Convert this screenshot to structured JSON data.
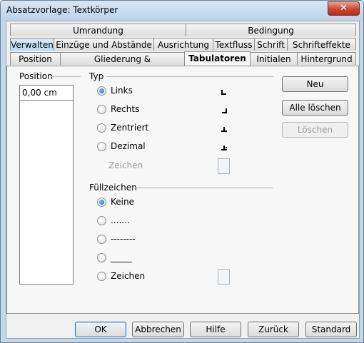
{
  "window": {
    "title": "Absatzvorlage: Textkörper",
    "close_label": "✕"
  },
  "tabs": {
    "row1": [
      "Umrandung",
      "Bedingung"
    ],
    "row2": [
      "Verwalten",
      "Einzüge und Abstände",
      "Ausrichtung",
      "Textfluss",
      "Schrift",
      "Schrifteffekte"
    ],
    "row3": [
      "Position",
      "Gliederung & Nummerierung",
      "Tabulatoren",
      "Initialen",
      "Hintergrund"
    ]
  },
  "position": {
    "label": "Position",
    "value": "0,00 cm"
  },
  "typ": {
    "label": "Typ",
    "options": [
      {
        "label": "Links",
        "checked": true
      },
      {
        "label": "Rechts",
        "checked": false
      },
      {
        "label": "Zentriert",
        "checked": false
      },
      {
        "label": "Dezimal",
        "checked": false
      }
    ],
    "zeichen_label": "Zeichen"
  },
  "fill": {
    "label": "Füllzeichen",
    "options": [
      {
        "label": "Keine",
        "checked": true
      },
      {
        "label": ".......",
        "checked": false
      },
      {
        "label": "--------",
        "checked": false
      },
      {
        "label": "_____",
        "checked": false
      },
      {
        "label": "Zeichen",
        "checked": false
      }
    ]
  },
  "buttons": {
    "neu": "Neu",
    "alle_loeschen": "Alle löschen",
    "loeschen": "Löschen",
    "ok": "OK",
    "abbrechen": "Abbrechen",
    "hilfe": "Hilfe",
    "zurueck": "Zurück",
    "standard": "Standard"
  }
}
